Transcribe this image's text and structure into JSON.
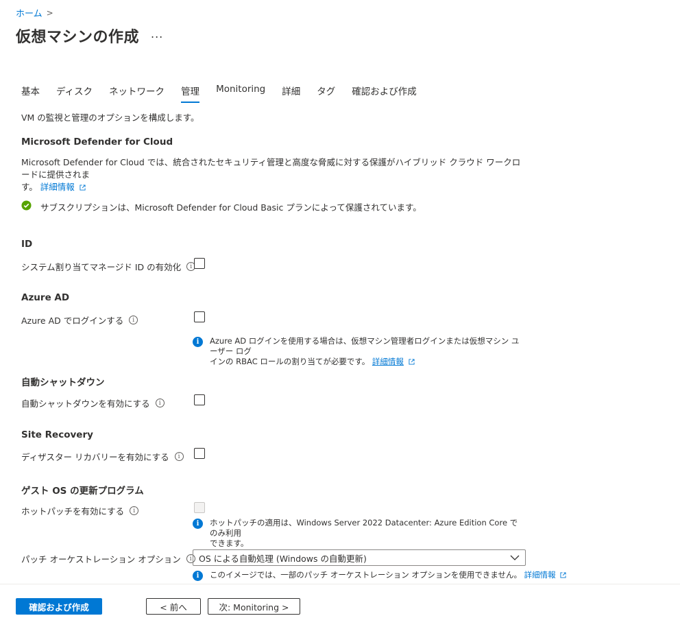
{
  "breadcrumb": {
    "home": "ホーム",
    "separator": ">"
  },
  "page": {
    "title": "仮想マシンの作成",
    "more": "..."
  },
  "tabs": [
    {
      "label": "基本"
    },
    {
      "label": "ディスク"
    },
    {
      "label": "ネットワーク"
    },
    {
      "label": "管理",
      "active": true
    },
    {
      "label": "Monitoring"
    },
    {
      "label": "詳細"
    },
    {
      "label": "タグ"
    },
    {
      "label": "確認および作成"
    }
  ],
  "description": "VM の監視と管理のオプションを構成します。",
  "defender": {
    "heading": "Microsoft Defender for Cloud",
    "text_line1": "Microsoft Defender for Cloud では、統合されたセキュリティ管理と高度な脅威に対する保護がハイブリッド クラウド ワークロードに提供されま",
    "text_line2": "す。",
    "learn_more": "詳細情報",
    "status": "サブスクリプションは、Microsoft Defender for Cloud Basic プランによって保護されています。"
  },
  "identity": {
    "heading": "ID",
    "system_identity_label": "システム割り当てマネージド ID の有効化",
    "checked": false
  },
  "azure_ad": {
    "heading": "Azure AD",
    "login_label": "Azure AD でログインする",
    "checked": false,
    "info_line1": "Azure AD ログインを使用する場合は、仮想マシン管理者ログインまたは仮想マシン ユーザー ログ",
    "info_line2": "インの RBAC ロールの割り当てが必要です。",
    "learn_more": "詳細情報"
  },
  "auto_shutdown": {
    "heading": "自動シャットダウン",
    "label": "自動シャットダウンを有効にする",
    "checked": false
  },
  "site_recovery": {
    "heading": "Site Recovery",
    "label": "ディザスター リカバリーを有効にする",
    "checked": false
  },
  "guest_os": {
    "heading": "ゲスト OS の更新プログラム",
    "hotpatch_label": "ホットパッチを有効にする",
    "hotpatch_disabled": true,
    "hotpatch_info_line1": "ホットパッチの適用は、Windows Server 2022 Datacenter: Azure Edition Core でのみ利用",
    "hotpatch_info_line2": "できます。",
    "patch_label": "パッチ オーケストレーション オプション",
    "patch_value": "OS による自動処理 (Windows の自動更新)",
    "patch_info": "このイメージでは、一部のパッチ オーケストレーション オプションを使用できません。",
    "learn_more": "詳細情報"
  },
  "footer": {
    "review_create": "確認および作成",
    "previous": "< 前へ",
    "next": "次: Monitoring >"
  },
  "colors": {
    "accent": "#0078d4",
    "success": "#57a300"
  }
}
